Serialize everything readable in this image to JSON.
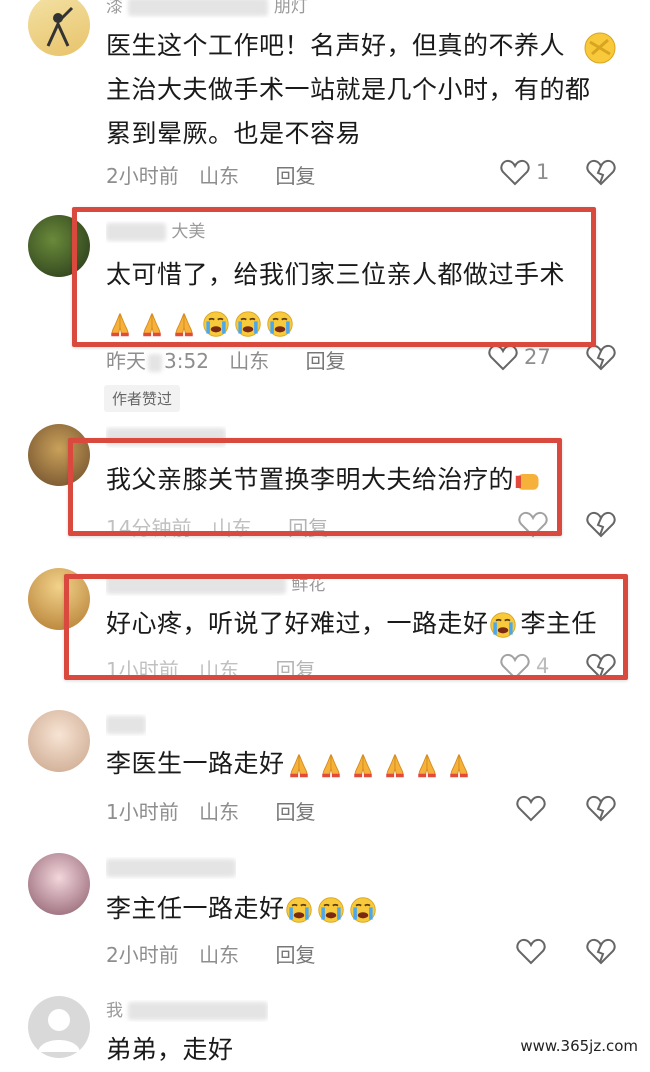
{
  "comments": [
    {
      "name": "漆",
      "name_suffix": "朋灯",
      "text_lines": [
        "医生这个工作吧！名声好，但真的不养人",
        "主治大夫做手术一站就是几个小时，有的都",
        "累到晕厥。也是不容易"
      ],
      "time": "2小时前",
      "location": "山东",
      "reply": "回复",
      "likes": "1"
    },
    {
      "name_suffix": "大美",
      "text_lines": [
        "太可惜了，给我们家三位亲人都做过手术"
      ],
      "emoji": [
        "pray-emoji",
        "pray-emoji",
        "pray-emoji",
        "crying-emoji",
        "crying-emoji",
        "crying-emoji"
      ],
      "time": "昨天",
      "time_suffix": "3:52",
      "location": "山东",
      "reply": "回复",
      "likes": "27",
      "badge": "作者赞过"
    },
    {
      "text_lines": [
        "我父亲膝关节置换李明大夫给治疗的"
      ],
      "time": "14分钟前",
      "location": "山东",
      "reply": "回复"
    },
    {
      "name_suffix": "鲜花",
      "text_lines": [
        "好心疼，听说了好难过，一路走好",
        "李主任"
      ],
      "time": "1小时前",
      "location": "山东",
      "reply": "回复",
      "likes": "4"
    },
    {
      "text_lines": [
        "李医生一路走好"
      ],
      "emoji": [
        "pray-emoji",
        "pray-emoji",
        "pray-emoji",
        "pray-emoji",
        "pray-emoji",
        "pray-emoji"
      ],
      "time": "1小时前",
      "location": "山东",
      "reply": "回复"
    },
    {
      "text_lines": [
        "李主任一路走好"
      ],
      "emoji": [
        "crying-emoji",
        "crying-emoji",
        "crying-emoji"
      ],
      "time": "2小时前",
      "location": "山东",
      "reply": "回复"
    },
    {
      "name": "我",
      "text_lines": [
        "弟弟，走好"
      ]
    }
  ],
  "watermark": "www.365jz.com",
  "colors": {
    "highlight_box": "#d9493e",
    "meta_gray": "#8e8e8e"
  }
}
